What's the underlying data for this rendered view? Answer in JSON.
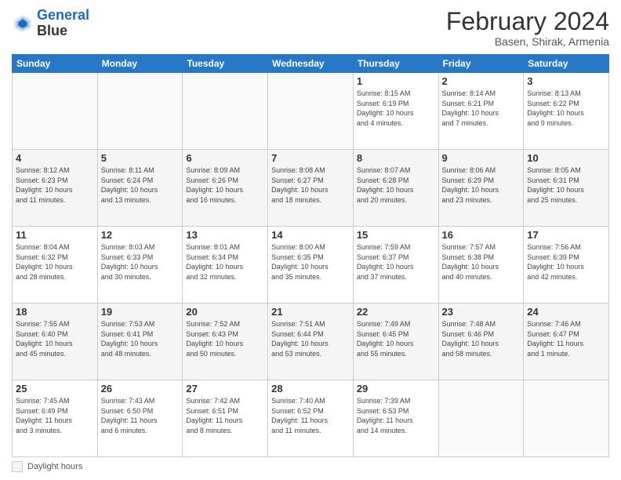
{
  "header": {
    "logo_line1": "General",
    "logo_line2": "Blue",
    "title": "February 2024",
    "subtitle": "Basen, Shirak, Armenia"
  },
  "days_header": [
    "Sunday",
    "Monday",
    "Tuesday",
    "Wednesday",
    "Thursday",
    "Friday",
    "Saturday"
  ],
  "legend_label": "Daylight hours",
  "weeks": [
    [
      {
        "num": "",
        "info": ""
      },
      {
        "num": "",
        "info": ""
      },
      {
        "num": "",
        "info": ""
      },
      {
        "num": "",
        "info": ""
      },
      {
        "num": "1",
        "info": "Sunrise: 8:15 AM\nSunset: 6:19 PM\nDaylight: 10 hours\nand 4 minutes."
      },
      {
        "num": "2",
        "info": "Sunrise: 8:14 AM\nSunset: 6:21 PM\nDaylight: 10 hours\nand 7 minutes."
      },
      {
        "num": "3",
        "info": "Sunrise: 8:13 AM\nSunset: 6:22 PM\nDaylight: 10 hours\nand 9 minutes."
      }
    ],
    [
      {
        "num": "4",
        "info": "Sunrise: 8:12 AM\nSunset: 6:23 PM\nDaylight: 10 hours\nand 11 minutes."
      },
      {
        "num": "5",
        "info": "Sunrise: 8:11 AM\nSunset: 6:24 PM\nDaylight: 10 hours\nand 13 minutes."
      },
      {
        "num": "6",
        "info": "Sunrise: 8:09 AM\nSunset: 6:26 PM\nDaylight: 10 hours\nand 16 minutes."
      },
      {
        "num": "7",
        "info": "Sunrise: 8:08 AM\nSunset: 6:27 PM\nDaylight: 10 hours\nand 18 minutes."
      },
      {
        "num": "8",
        "info": "Sunrise: 8:07 AM\nSunset: 6:28 PM\nDaylight: 10 hours\nand 20 minutes."
      },
      {
        "num": "9",
        "info": "Sunrise: 8:06 AM\nSunset: 6:29 PM\nDaylight: 10 hours\nand 23 minutes."
      },
      {
        "num": "10",
        "info": "Sunrise: 8:05 AM\nSunset: 6:31 PM\nDaylight: 10 hours\nand 25 minutes."
      }
    ],
    [
      {
        "num": "11",
        "info": "Sunrise: 8:04 AM\nSunset: 6:32 PM\nDaylight: 10 hours\nand 28 minutes."
      },
      {
        "num": "12",
        "info": "Sunrise: 8:03 AM\nSunset: 6:33 PM\nDaylight: 10 hours\nand 30 minutes."
      },
      {
        "num": "13",
        "info": "Sunrise: 8:01 AM\nSunset: 6:34 PM\nDaylight: 10 hours\nand 32 minutes."
      },
      {
        "num": "14",
        "info": "Sunrise: 8:00 AM\nSunset: 6:35 PM\nDaylight: 10 hours\nand 35 minutes."
      },
      {
        "num": "15",
        "info": "Sunrise: 7:59 AM\nSunset: 6:37 PM\nDaylight: 10 hours\nand 37 minutes."
      },
      {
        "num": "16",
        "info": "Sunrise: 7:57 AM\nSunset: 6:38 PM\nDaylight: 10 hours\nand 40 minutes."
      },
      {
        "num": "17",
        "info": "Sunrise: 7:56 AM\nSunset: 6:39 PM\nDaylight: 10 hours\nand 42 minutes."
      }
    ],
    [
      {
        "num": "18",
        "info": "Sunrise: 7:55 AM\nSunset: 6:40 PM\nDaylight: 10 hours\nand 45 minutes."
      },
      {
        "num": "19",
        "info": "Sunrise: 7:53 AM\nSunset: 6:41 PM\nDaylight: 10 hours\nand 48 minutes."
      },
      {
        "num": "20",
        "info": "Sunrise: 7:52 AM\nSunset: 6:43 PM\nDaylight: 10 hours\nand 50 minutes."
      },
      {
        "num": "21",
        "info": "Sunrise: 7:51 AM\nSunset: 6:44 PM\nDaylight: 10 hours\nand 53 minutes."
      },
      {
        "num": "22",
        "info": "Sunrise: 7:49 AM\nSunset: 6:45 PM\nDaylight: 10 hours\nand 55 minutes."
      },
      {
        "num": "23",
        "info": "Sunrise: 7:48 AM\nSunset: 6:46 PM\nDaylight: 10 hours\nand 58 minutes."
      },
      {
        "num": "24",
        "info": "Sunrise: 7:46 AM\nSunset: 6:47 PM\nDaylight: 11 hours\nand 1 minute."
      }
    ],
    [
      {
        "num": "25",
        "info": "Sunrise: 7:45 AM\nSunset: 6:49 PM\nDaylight: 11 hours\nand 3 minutes."
      },
      {
        "num": "26",
        "info": "Sunrise: 7:43 AM\nSunset: 6:50 PM\nDaylight: 11 hours\nand 6 minutes."
      },
      {
        "num": "27",
        "info": "Sunrise: 7:42 AM\nSunset: 6:51 PM\nDaylight: 11 hours\nand 8 minutes."
      },
      {
        "num": "28",
        "info": "Sunrise: 7:40 AM\nSunset: 6:52 PM\nDaylight: 11 hours\nand 11 minutes."
      },
      {
        "num": "29",
        "info": "Sunrise: 7:39 AM\nSunset: 6:53 PM\nDaylight: 11 hours\nand 14 minutes."
      },
      {
        "num": "",
        "info": ""
      },
      {
        "num": "",
        "info": ""
      }
    ]
  ]
}
